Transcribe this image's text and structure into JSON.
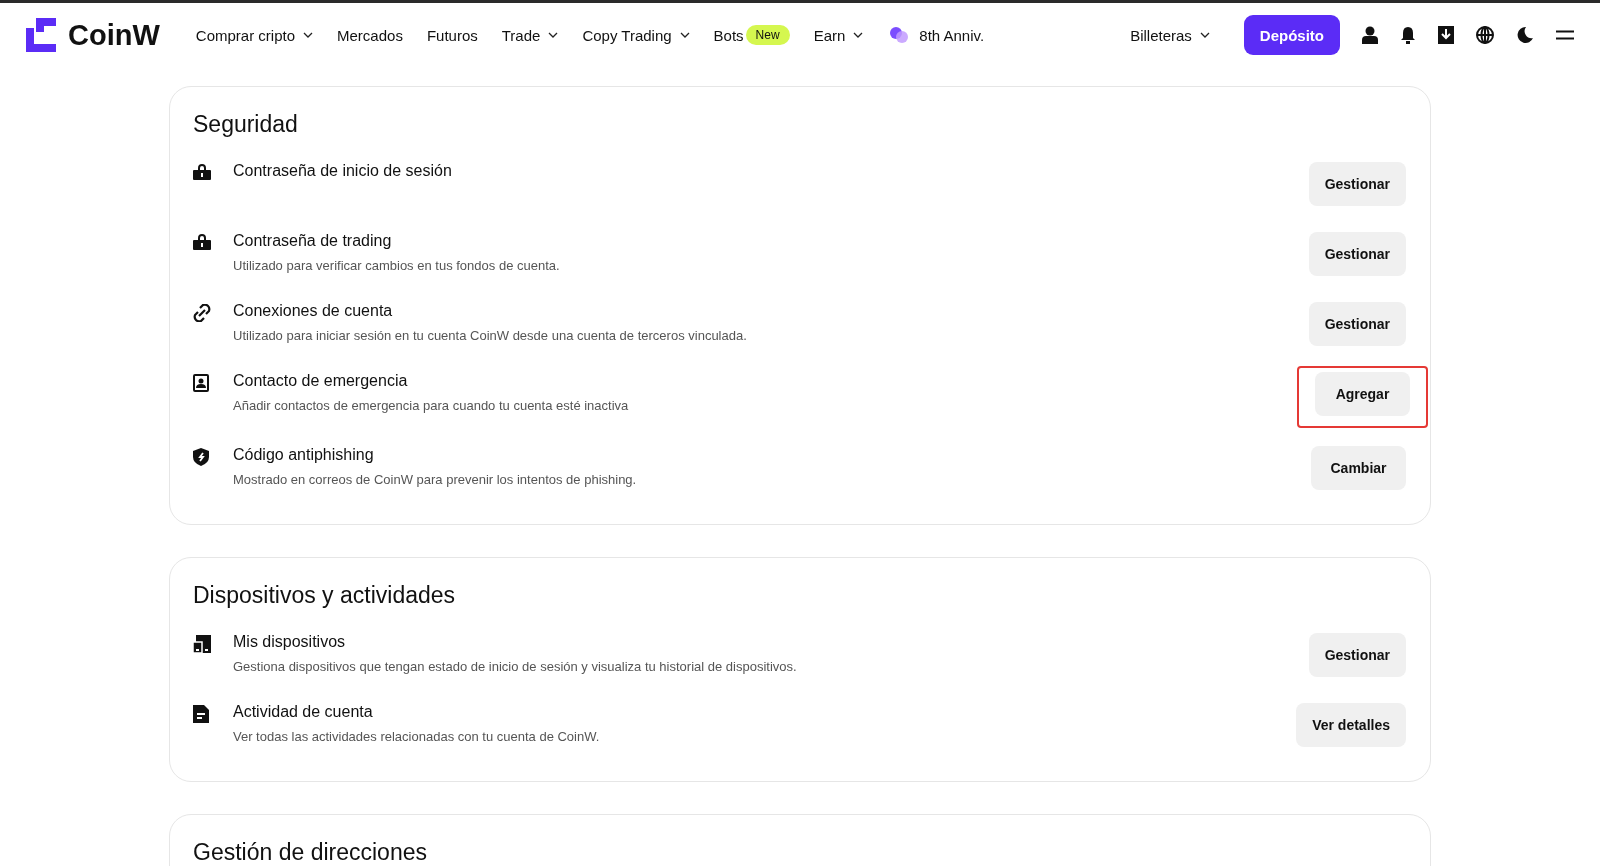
{
  "logo": {
    "text": "CoinW"
  },
  "nav": [
    {
      "label": "Comprar cripto",
      "dropdown": true
    },
    {
      "label": "Mercados",
      "dropdown": false
    },
    {
      "label": "Futuros",
      "dropdown": false
    },
    {
      "label": "Trade",
      "dropdown": true
    },
    {
      "label": "Copy Trading",
      "dropdown": true
    },
    {
      "label": "Bots",
      "dropdown": false,
      "badge": "New"
    },
    {
      "label": "Earn",
      "dropdown": true
    },
    {
      "label": "8th Anniv.",
      "dropdown": false,
      "kind": "anniversary"
    }
  ],
  "wallets": {
    "label": "Billeteras",
    "dropdown": true
  },
  "deposit_button": "Depósito",
  "sections": [
    {
      "title": "Seguridad",
      "items": [
        {
          "kind": "lock",
          "title": "Contraseña de inicio de sesión",
          "action": "Gestionar",
          "highlighted": false
        },
        {
          "kind": "lock",
          "title": "Contraseña de trading",
          "description": "Utilizado para verificar cambios en tus fondos de cuenta.",
          "action": "Gestionar",
          "highlighted": false
        },
        {
          "kind": "link",
          "title": "Conexiones de cuenta",
          "description": "Utilizado para iniciar sesión en tu cuenta CoinW desde una cuenta de terceros vinculada.",
          "action": "Gestionar",
          "highlighted": false
        },
        {
          "kind": "contact",
          "title": "Contacto de emergencia",
          "description": "Añadir contactos de emergencia para cuando tu cuenta esté inactiva",
          "action": "Agregar",
          "highlighted": true
        },
        {
          "kind": "shield",
          "title": "Código antiphishing",
          "description": "Mostrado en correos de CoinW para prevenir los intentos de phishing.",
          "action": "Cambiar",
          "highlighted": false
        }
      ]
    },
    {
      "title": "Dispositivos y actividades",
      "items": [
        {
          "kind": "device",
          "title": "Mis dispositivos",
          "description": "Gestiona dispositivos que tengan estado de inicio de sesión y visualiza tu historial de dispositivos.",
          "action": "Gestionar",
          "highlighted": false
        },
        {
          "kind": "document",
          "title": "Actividad de cuenta",
          "description": "Ver todas las actividades relacionadas con tu cuenta de CoinW.",
          "action": "Ver detalles",
          "highlighted": false
        }
      ]
    },
    {
      "title": "Gestión de direcciones"
    }
  ]
}
